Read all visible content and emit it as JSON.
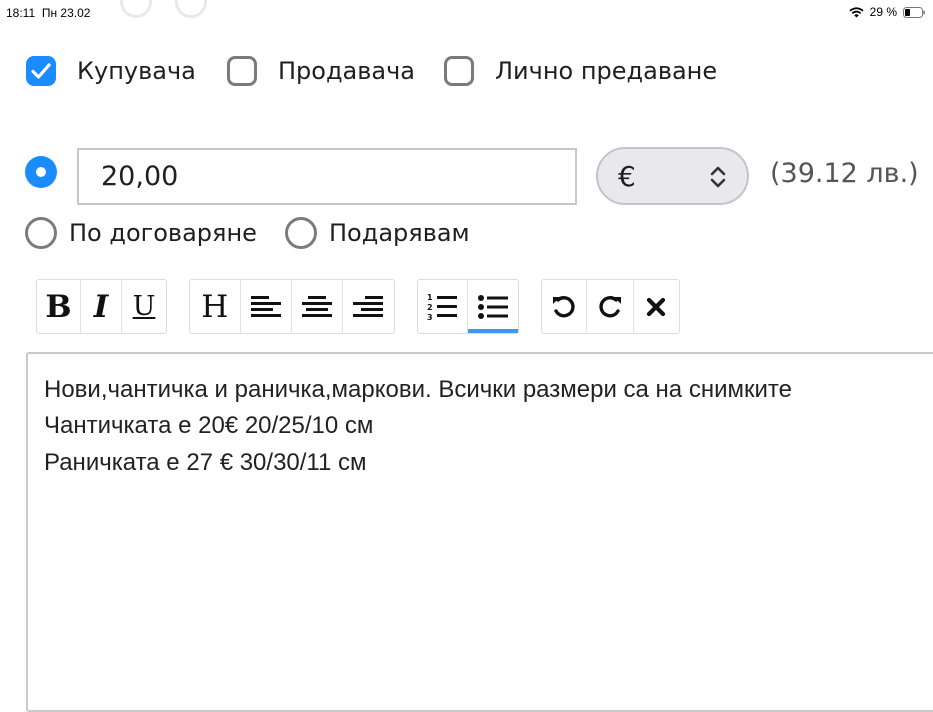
{
  "status_bar": {
    "time": "18:11",
    "date": "Пн 23.02",
    "battery": "29 %"
  },
  "delivery_payer": {
    "options": [
      {
        "label": "Купувача",
        "checked": true
      },
      {
        "label": "Продавача",
        "checked": false
      },
      {
        "label": "Лично предаване",
        "checked": false
      }
    ]
  },
  "price": {
    "value": "20,00",
    "currency": "€",
    "converted": "(39.12 лв.)",
    "options": [
      {
        "label": "По договаряне",
        "selected": false
      },
      {
        "label": "Подарявам",
        "selected": false
      }
    ]
  },
  "toolbar": {
    "bold": "B",
    "italic": "I",
    "underline": "U",
    "heading": "H"
  },
  "editor": {
    "lines": [
      "Нови,чантичка и раничка,маркови. Всички размери са на снимките",
      "Чантичката е 20€ 20/25/10 см",
      "Раничката е 27 € 30/30/11 см"
    ]
  },
  "colors": {
    "accent": "#1a8cff",
    "active_underline": "#3d9ae8"
  }
}
